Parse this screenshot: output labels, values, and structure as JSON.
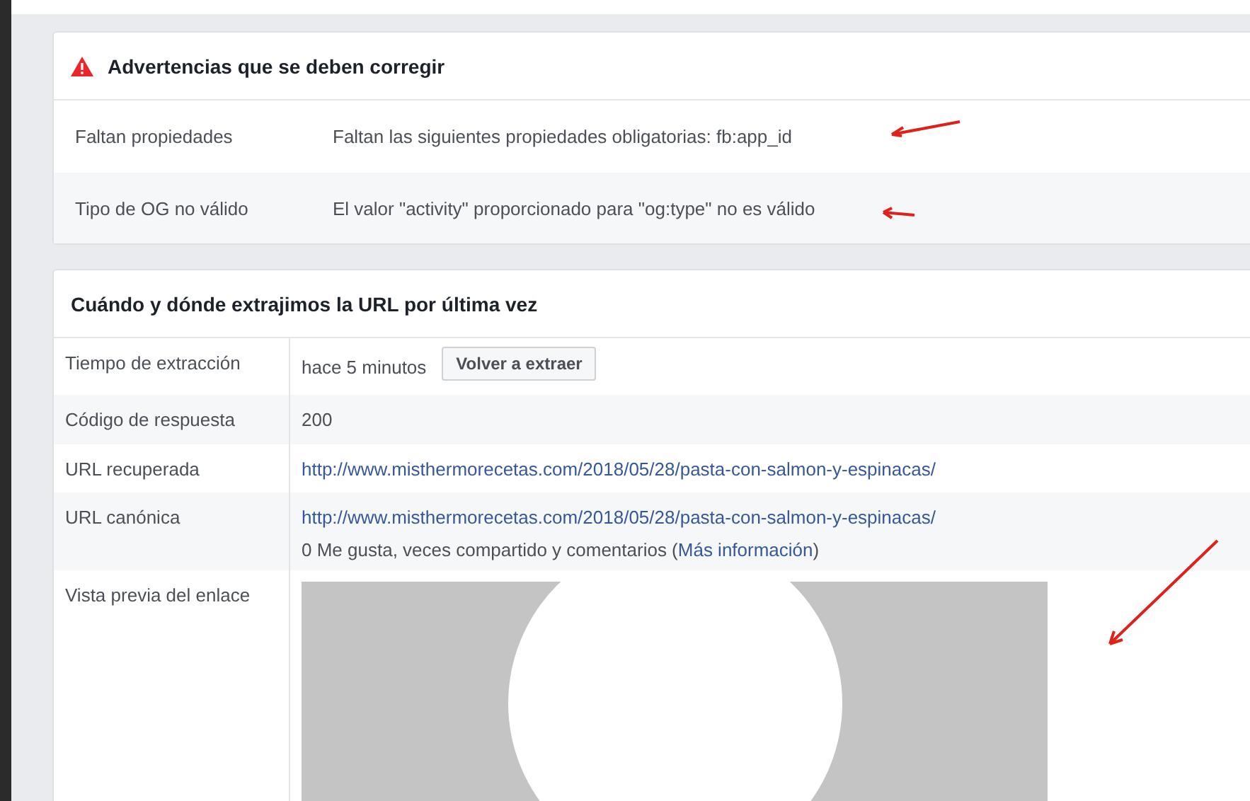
{
  "warnings": {
    "title": "Advertencias que se deben corregir",
    "rows": [
      {
        "label": "Faltan propiedades",
        "message": "Faltan las siguientes propiedades obligatorias: fb:app_id"
      },
      {
        "label": "Tipo de OG no válido",
        "message": "El valor \"activity\" proporcionado para \"og:type\" no es válido"
      }
    ]
  },
  "scrape": {
    "title": "Cuándo y dónde extrajimos la URL por última vez",
    "rows": [
      {
        "kind": "time",
        "label": "Tiempo de extracción",
        "value": "hace 5 minutos",
        "button": "Volver a extraer"
      },
      {
        "kind": "text",
        "label": "Código de respuesta",
        "value": "200"
      },
      {
        "kind": "link",
        "label": "URL recuperada",
        "value": "http://www.misthermorecetas.com/2018/05/28/pasta-con-salmon-y-espinacas/"
      },
      {
        "kind": "link_note",
        "label": "URL canónica",
        "value": "http://www.misthermorecetas.com/2018/05/28/pasta-con-salmon-y-espinacas/",
        "note_before": "0 Me gusta, veces compartido y comentarios (",
        "note_link": "Más información",
        "note_after": ")"
      },
      {
        "kind": "preview",
        "label": "Vista previa del enlace"
      }
    ]
  }
}
